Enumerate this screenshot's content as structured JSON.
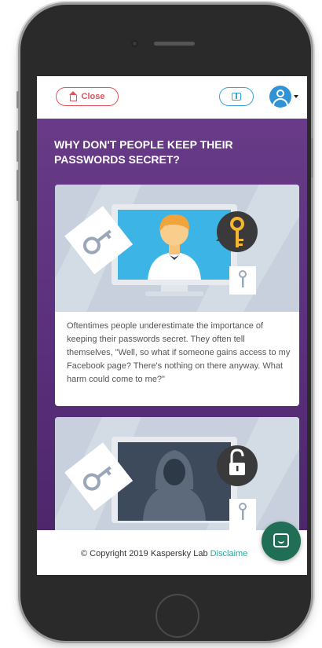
{
  "topbar": {
    "close_label": "Close",
    "icons": [
      "home-icon",
      "book-icon",
      "user-avatar-icon",
      "caret-down-icon"
    ]
  },
  "page": {
    "title": "WHY DON'T PEOPLE KEEP THEIR PASSWORDS SECRET?"
  },
  "cards": [
    {
      "illustration": "person-at-monitor-with-key-bubble",
      "text": "Oftentimes people underestimate the importance of keeping their passwords secret. They often tell themselves, \"Well, so what if someone gains access to my Facebook page? There's nothing on there anyway. What harm could come to me?\""
    },
    {
      "illustration": "hooded-hacker-with-padlock"
    }
  ],
  "footer": {
    "copyright": "© Copyright 2019 Kaspersky Lab",
    "disclaimer_label": "Disclaime"
  },
  "colors": {
    "background_purple": "#5a2f7b",
    "close_red": "#e0525c",
    "accent_blue": "#3aa0d8",
    "chat_green": "#1f6e55",
    "link_teal": "#2aa59a"
  }
}
